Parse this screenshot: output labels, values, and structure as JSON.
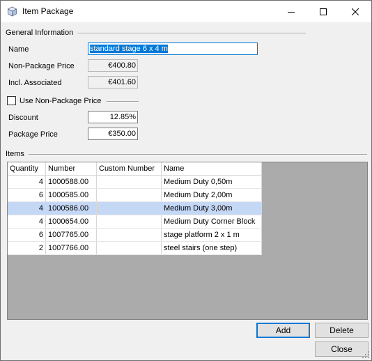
{
  "window": {
    "title": "Item Package",
    "icons": {
      "app": "package-cube-icon",
      "minimize": "minimize-icon",
      "maximize": "maximize-icon",
      "close": "close-icon"
    }
  },
  "general": {
    "section_label": "General Information",
    "name_label": "Name",
    "name_value": "standard stage 6 x 4 m",
    "nonpackage_label": "Non-Package Price",
    "nonpackage_value": "€400.80",
    "incl_label": "Incl. Associated",
    "incl_value": "€401.60",
    "use_nonpackage_label": "Use Non-Package Price",
    "use_nonpackage_checked": false,
    "discount_label": "Discount",
    "discount_value": "12.85%",
    "package_price_label": "Package Price",
    "package_price_value": "€350.00"
  },
  "items": {
    "section_label": "Items",
    "columns": [
      "Quantity",
      "Number",
      "Custom Number",
      "Name"
    ],
    "rows": [
      {
        "quantity": "4",
        "number": "1000588.00",
        "custom_number": "",
        "name": "Medium Duty 0,50m"
      },
      {
        "quantity": "6",
        "number": "1000585.00",
        "custom_number": "",
        "name": "Medium Duty 2,00m"
      },
      {
        "quantity": "4",
        "number": "1000586.00",
        "custom_number": "",
        "name": "Medium Duty 3,00m"
      },
      {
        "quantity": "4",
        "number": "1000654.00",
        "custom_number": "",
        "name": "Medium Duty Corner Block"
      },
      {
        "quantity": "6",
        "number": "1007765.00",
        "custom_number": "",
        "name": "stage platform 2 x 1 m"
      },
      {
        "quantity": "2",
        "number": "1007766.00",
        "custom_number": "",
        "name": "steel stairs (one step)"
      }
    ],
    "selected_row": 2
  },
  "buttons": {
    "add": "Add",
    "delete": "Delete",
    "close": "Close"
  },
  "colors": {
    "accent": "#0078d7",
    "selected_row": "#c4d7f5",
    "grid_background": "#ababab"
  }
}
